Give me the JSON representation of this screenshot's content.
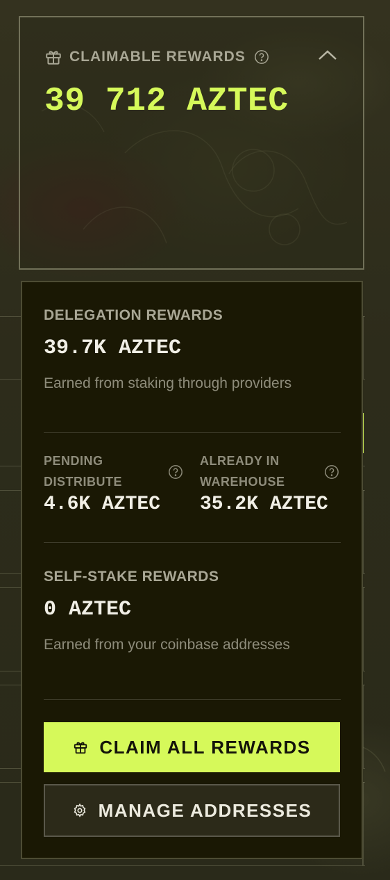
{
  "claimable": {
    "title": "CLAIMABLE REWARDS",
    "amount": "39 712 AZTEC",
    "icon": "gift-icon",
    "help_icon": "help-circle-icon",
    "toggle_icon": "chevron-up-icon"
  },
  "delegation": {
    "title": "DELEGATION REWARDS",
    "value": "39.7K AZTEC",
    "description": "Earned from staking through providers"
  },
  "pending": {
    "title_line1": "PENDING",
    "title_line2": "DISTRIBUTE",
    "value": "4.6K AZTEC"
  },
  "warehouse": {
    "title_line1": "ALREADY IN",
    "title_line2": "WAREHOUSE",
    "value": "35.2K AZTEC"
  },
  "self_stake": {
    "title": "SELF-STAKE REWARDS",
    "value": "0 AZTEC",
    "description": "Earned from your coinbase addresses"
  },
  "actions": {
    "claim_label": "CLAIM ALL REWARDS",
    "manage_label": "MANAGE ADDRESSES"
  },
  "colors": {
    "accent": "#d6f95a",
    "panel_bg": "#1a1804",
    "page_bg": "#2b2b1a"
  }
}
